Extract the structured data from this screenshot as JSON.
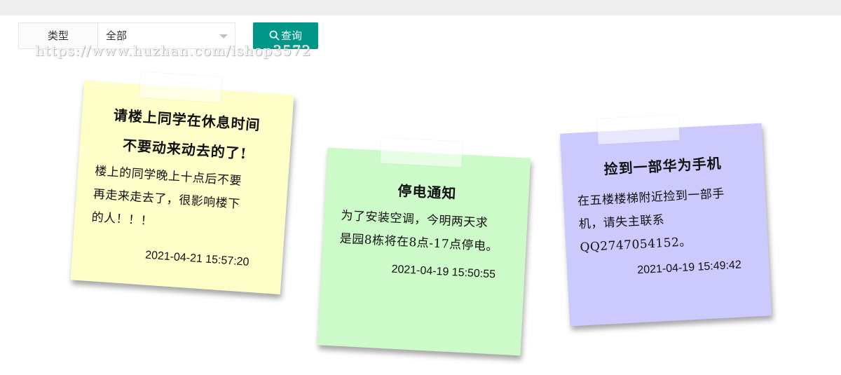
{
  "filter": {
    "label": "类型",
    "selected": "全部"
  },
  "actions": {
    "query_label": "查询"
  },
  "watermark": "https://www.huzhan.com/ishop3572",
  "notes": [
    {
      "title_line1": "请楼上同学在休息时间",
      "title_line2": "不要动来动去的了!",
      "content": [
        "楼上的同学晚上十点后不要",
        "再走来走去了，很影响楼下",
        "的人！！！"
      ],
      "date": "2021-04-21 15:57:20",
      "color": "#fefec8"
    },
    {
      "title_line1": "停电通知",
      "content": [
        "为了安装空调，今明两天求",
        "是园8栋将在8点-17点停电。"
      ],
      "date": "2021-04-19 15:50:55",
      "color": "#ccfac8"
    },
    {
      "title_line1": "捡到一部华为手机",
      "content": [
        "在五楼楼梯附近捡到一部手",
        "机，请失主联系",
        "QQ2747054152。"
      ],
      "date": "2021-04-19 15:49:42",
      "color": "#cccafc"
    }
  ],
  "colors": {
    "accent": "#009688",
    "topbar": "#efefef"
  }
}
